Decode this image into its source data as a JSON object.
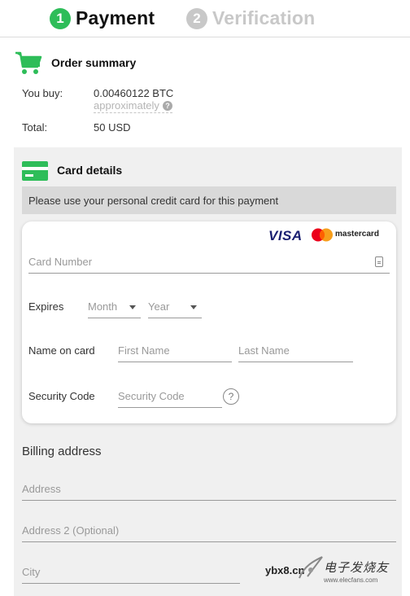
{
  "steps": [
    {
      "number": "1",
      "label": "Payment",
      "active": true
    },
    {
      "number": "2",
      "label": "Verification",
      "active": false
    }
  ],
  "colors": {
    "accent": "#2ebd59",
    "inactive": "#c8c8c8",
    "panel": "#f0f0f0"
  },
  "order_summary": {
    "icon": "shopping-cart-icon",
    "title": "Order summary",
    "buy_label": "You buy:",
    "buy_value": "0.00460122 BTC",
    "approx_text": "approximately",
    "approx_help": "?",
    "total_label": "Total:",
    "total_value": "50 USD"
  },
  "card_details": {
    "icon": "credit-card-icon",
    "title": "Card details",
    "notice": "Please use your personal credit card for this payment",
    "brands": {
      "visa": "VISA",
      "mastercard": "mastercard"
    },
    "card_number_placeholder": "Card Number",
    "expires_label": "Expires",
    "month_value": "Month",
    "year_value": "Year",
    "name_label": "Name on card",
    "first_name_placeholder": "First Name",
    "last_name_placeholder": "Last Name",
    "security_label": "Security Code",
    "security_placeholder": "Security Code",
    "security_help": "?"
  },
  "billing": {
    "title": "Billing address",
    "address_placeholder": "Address",
    "address2_placeholder": "Address 2 (Optional)",
    "city_placeholder": "City"
  },
  "watermark": {
    "left_text": "ybx8.cn",
    "logo_text": "电子发烧友",
    "url": "www.elecfans.com"
  }
}
